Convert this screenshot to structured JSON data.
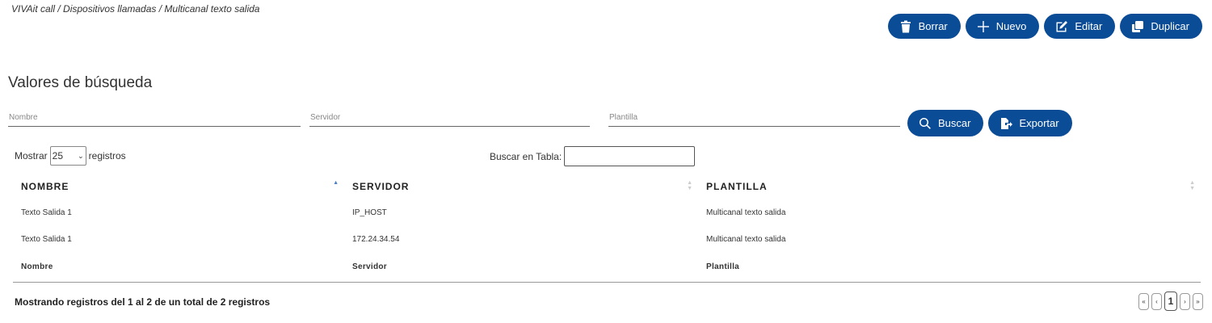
{
  "breadcrumb": "VIVAit call / Dispositivos llamadas / Multicanal texto salida",
  "toolbar": {
    "delete_label": "Borrar",
    "new_label": "Nuevo",
    "edit_label": "Editar",
    "duplicate_label": "Duplicar"
  },
  "search_section": {
    "title": "Valores de búsqueda",
    "nombre_placeholder": "Nombre",
    "servidor_placeholder": "Servidor",
    "plantilla_placeholder": "Plantilla",
    "search_label": "Buscar",
    "export_label": "Exportar"
  },
  "table_controls": {
    "show_prefix": "Mostrar",
    "page_length": "25",
    "show_suffix": "registros",
    "search_label": "Buscar en Tabla:"
  },
  "table": {
    "headers": [
      "NOMBRE",
      "SERVIDOR",
      "PLANTILLA"
    ],
    "rows": [
      [
        "Texto Salida 1",
        "IP_HOST",
        "Multicanal texto salida"
      ],
      [
        "Texto Salida 1",
        "172.24.34.54",
        "Multicanal texto salida"
      ]
    ],
    "footers": [
      "Nombre",
      "Servidor",
      "Plantilla"
    ]
  },
  "info_text": "Mostrando registros del 1 al 2 de un total de 2 registros",
  "pagination": {
    "first": "«",
    "prev": "‹",
    "current": "1",
    "next": "›",
    "last": "»"
  },
  "colors": {
    "primary": "#0b4c96"
  }
}
